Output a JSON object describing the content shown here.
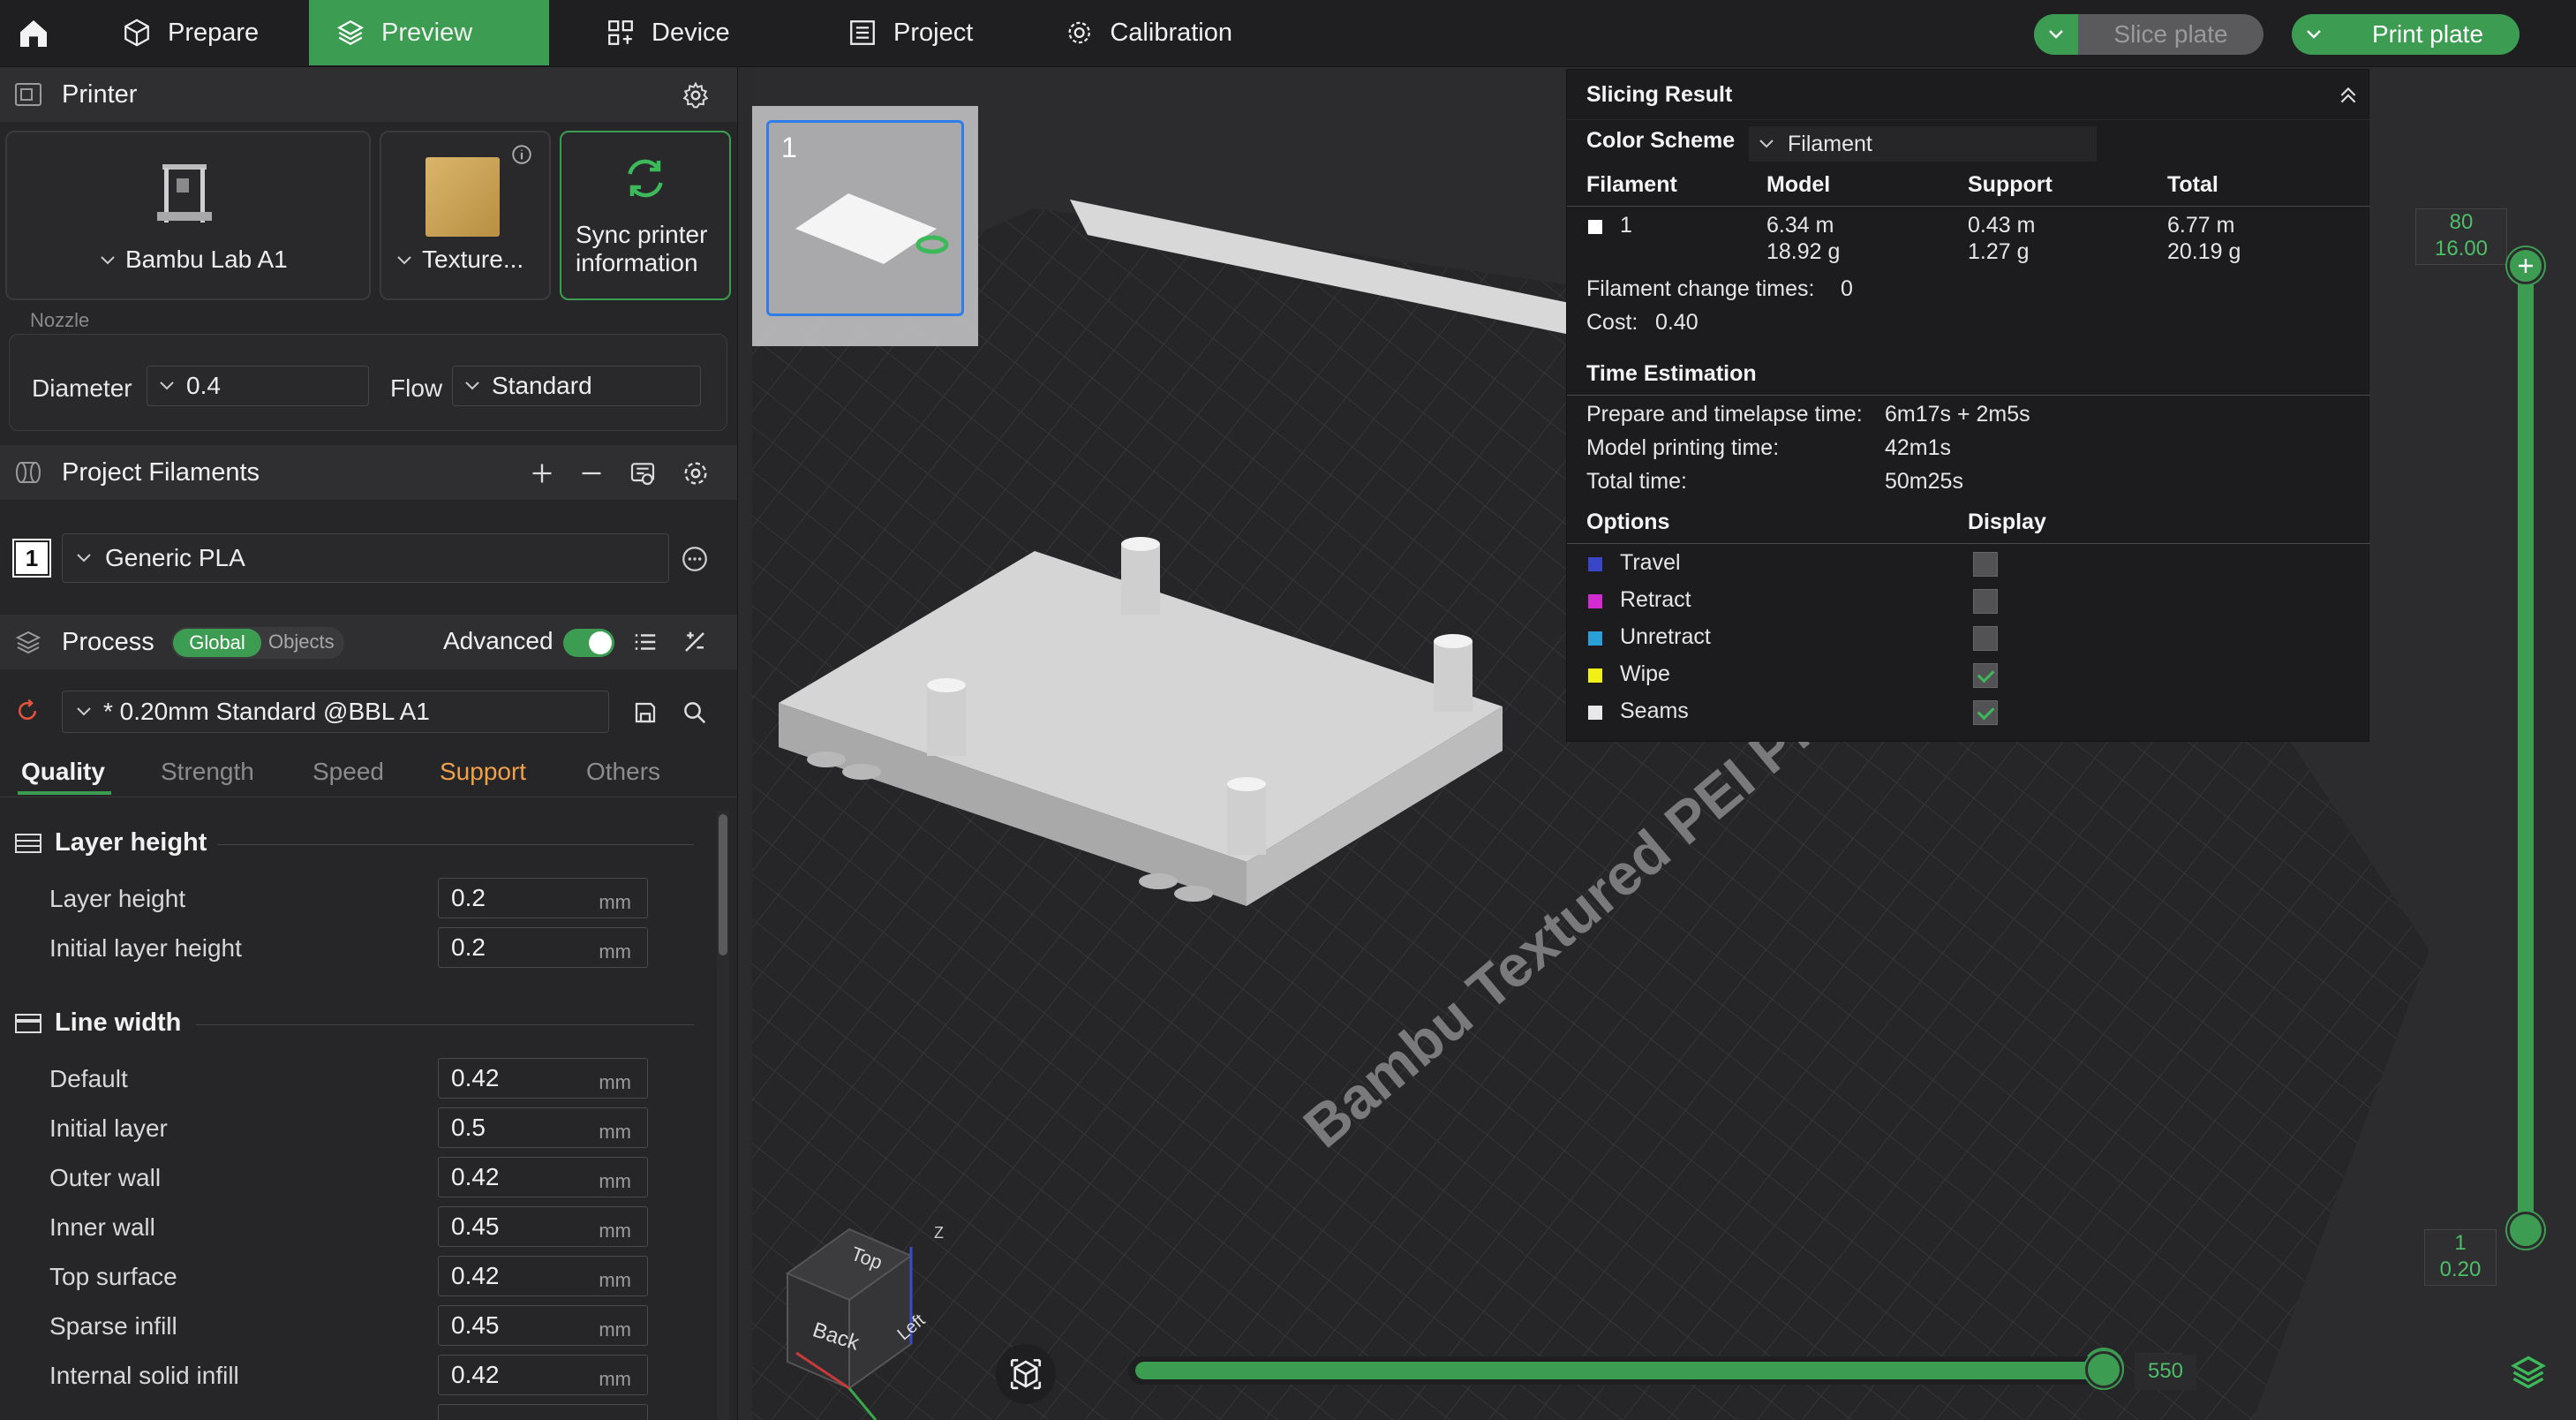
{
  "topbar": {
    "tabs": [
      {
        "label": "Prepare",
        "icon": "cube-icon"
      },
      {
        "label": "Preview",
        "icon": "layers-icon"
      },
      {
        "label": "Device",
        "icon": "device-icon"
      },
      {
        "label": "Project",
        "icon": "project-icon"
      },
      {
        "label": "Calibration",
        "icon": "calibration-icon"
      }
    ],
    "slice_label": "Slice plate",
    "print_label": "Print plate",
    "accent": "#3c9d52"
  },
  "printer": {
    "title": "Printer",
    "model_label": "Bambu Lab A1",
    "plate_label": "Texture...",
    "sync_label_1": "Sync printer",
    "sync_label_2": "information",
    "nozzle_title": "Nozzle",
    "diameter_label": "Diameter",
    "diameter_value": "0.4",
    "flow_label": "Flow",
    "flow_value": "Standard"
  },
  "filaments": {
    "title": "Project Filaments",
    "items": [
      {
        "index": "1",
        "name": "Generic PLA"
      }
    ]
  },
  "process": {
    "title": "Process",
    "toggle_global": "Global",
    "toggle_objects": "Objects",
    "advanced_label": "Advanced",
    "preset": "* 0.20mm Standard @BBL A1",
    "tabs": [
      "Quality",
      "Strength",
      "Speed",
      "Support",
      "Others"
    ],
    "groups": [
      {
        "title": "Layer height",
        "params": [
          {
            "label": "Layer height",
            "value": "0.2",
            "unit": "mm"
          },
          {
            "label": "Initial layer height",
            "value": "0.2",
            "unit": "mm"
          }
        ]
      },
      {
        "title": "Line width",
        "params": [
          {
            "label": "Default",
            "value": "0.42",
            "unit": "mm"
          },
          {
            "label": "Initial layer",
            "value": "0.5",
            "unit": "mm"
          },
          {
            "label": "Outer wall",
            "value": "0.42",
            "unit": "mm"
          },
          {
            "label": "Inner wall",
            "value": "0.45",
            "unit": "mm"
          },
          {
            "label": "Top surface",
            "value": "0.42",
            "unit": "mm"
          },
          {
            "label": "Sparse infill",
            "value": "0.45",
            "unit": "mm"
          },
          {
            "label": "Internal solid infill",
            "value": "0.42",
            "unit": "mm"
          }
        ]
      }
    ]
  },
  "viewport": {
    "plate_thumbnail_number": "1",
    "plate_name": "Bambu Textured PEI Plate",
    "cube_labels": {
      "top": "Top",
      "back": "Back",
      "left": "Left",
      "z": "Z"
    }
  },
  "slicing_result": {
    "title": "Slicing Result",
    "color_scheme_label": "Color Scheme",
    "color_scheme_value": "Filament",
    "headers": {
      "filament": "Filament",
      "model": "Model",
      "support": "Support",
      "total": "Total"
    },
    "row": {
      "filament": "1",
      "model_len": "6.34 m",
      "model_wt": "18.92 g",
      "support_len": "0.43 m",
      "support_wt": "1.27 g",
      "total_len": "6.77 m",
      "total_wt": "20.19 g"
    },
    "change_times_label": "Filament change times:",
    "change_times_value": "0",
    "cost_label": "Cost:",
    "cost_value": "0.40",
    "time_title": "Time Estimation",
    "prepare_label": "Prepare and timelapse time:",
    "prepare_value": "6m17s + 2m5s",
    "model_time_label": "Model printing time:",
    "model_time_value": "42m1s",
    "total_time_label": "Total time:",
    "total_time_value": "50m25s",
    "options_title": "Options",
    "display_title": "Display",
    "options": [
      {
        "label": "Travel",
        "color": "#3a46c8",
        "checked": false
      },
      {
        "label": "Retract",
        "color": "#d22bd2",
        "checked": false
      },
      {
        "label": "Unretract",
        "color": "#2aa0d8",
        "checked": false
      },
      {
        "label": "Wipe",
        "color": "#f2ef16",
        "checked": true
      },
      {
        "label": "Seams",
        "color": "#e8e8e8",
        "checked": true
      }
    ]
  },
  "layer_slider": {
    "top_layer": "80",
    "top_height": "16.00",
    "bottom_layer": "1",
    "bottom_height": "0.20"
  },
  "move_slider": {
    "value": "550"
  }
}
